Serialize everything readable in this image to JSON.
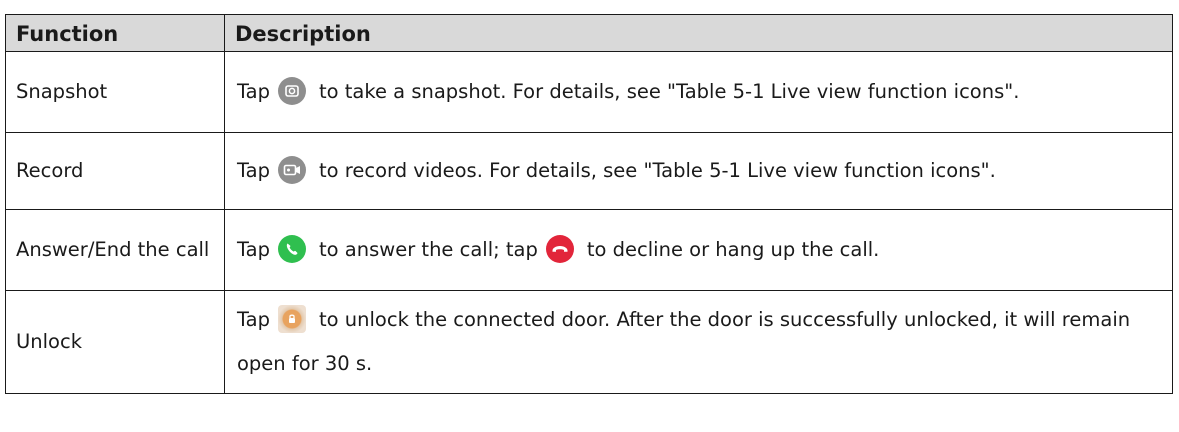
{
  "table": {
    "headers": [
      "Function",
      "Description"
    ],
    "rows": [
      {
        "function": "Snapshot",
        "desc_before": "Tap",
        "icon": "camera-icon",
        "desc_after": "to take a snapshot. For details, see \"Table 5-1 Live view function icons\"."
      },
      {
        "function": "Record",
        "desc_before": "Tap",
        "icon": "video-record-icon",
        "desc_after": "to record videos. For details, see \"Table 5-1 Live view function icons\"."
      },
      {
        "function": "Answer/End the call",
        "desc_before": "Tap",
        "icon": "answer-call-icon",
        "desc_mid": "to answer the call; tap",
        "icon2": "hang-up-icon",
        "desc_after": "to decline or hang up the call."
      },
      {
        "function": "Unlock",
        "desc_before": "Tap",
        "icon": "unlock-icon",
        "desc_after": "to unlock the connected door. After the door is successfully unlocked, it will remain open for 30 s."
      }
    ]
  },
  "colors": {
    "header_bg": "#d9d9d9",
    "border": "#1a1a1a",
    "icon_gray": "#8e8e8e",
    "answer_green": "#2fbf4f",
    "hangup_red": "#e2253a",
    "unlock_orange": "#e8a35f"
  }
}
